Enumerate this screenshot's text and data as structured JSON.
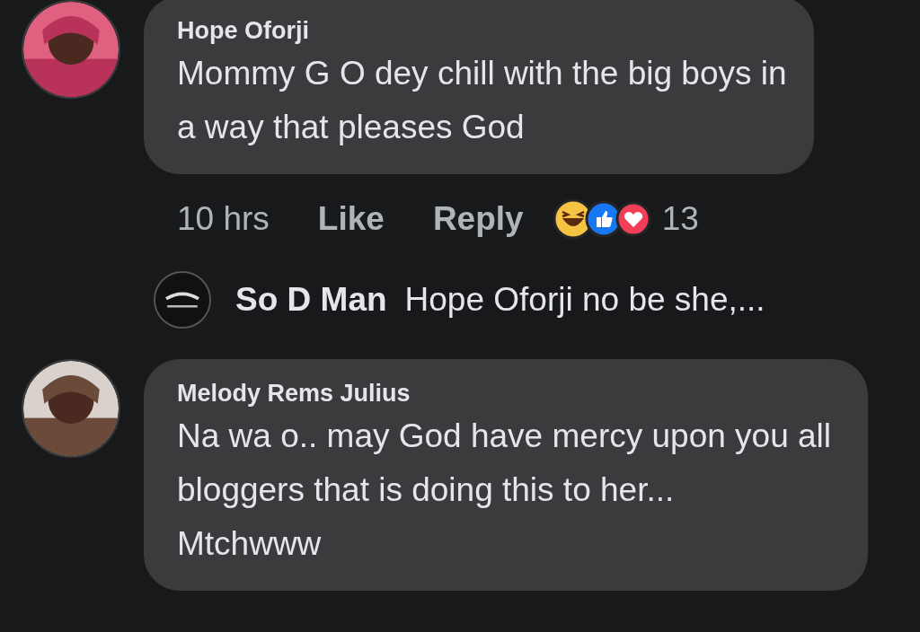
{
  "comments": [
    {
      "author": "Hope Oforji",
      "text": "Mommy G O dey chill with the big boys in a way that pleases God",
      "time": "10 hrs",
      "actions": [
        "Like",
        "Reply"
      ],
      "reaction_count": "13",
      "replies": [
        {
          "author": "So D Man",
          "text": "Hope Oforji no be she,..."
        }
      ]
    },
    {
      "author": "Melody Rems Julius",
      "text": "Na wa o.. may God have mercy upon you all bloggers that is doing this to her...\nMtchwww"
    }
  ]
}
